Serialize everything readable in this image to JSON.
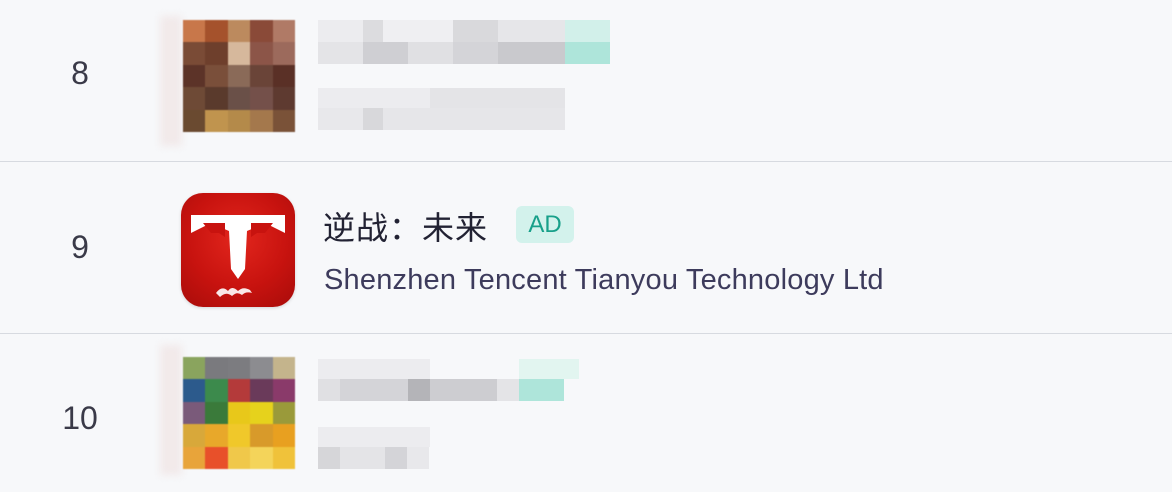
{
  "ranking": {
    "rows": [
      {
        "rank": "8",
        "title": "",
        "developer": "",
        "icon": "blurred-app-icon",
        "redacted": true
      },
      {
        "rank": "9",
        "title": "逆战：未来",
        "badge": "AD",
        "developer": "Shenzhen Tencent Tianyou Technology Ltd",
        "icon": "nizhan-app-icon",
        "redacted": false
      },
      {
        "rank": "10",
        "title": "",
        "developer": "",
        "icon": "blurred-app-icon",
        "redacted": true
      }
    ]
  },
  "colors": {
    "background": "#f7f8fa",
    "divider": "#d7dae0",
    "ad_badge_bg": "#d3f2ec",
    "ad_badge_text": "#18a08a",
    "icon_red": "#c8130f"
  }
}
